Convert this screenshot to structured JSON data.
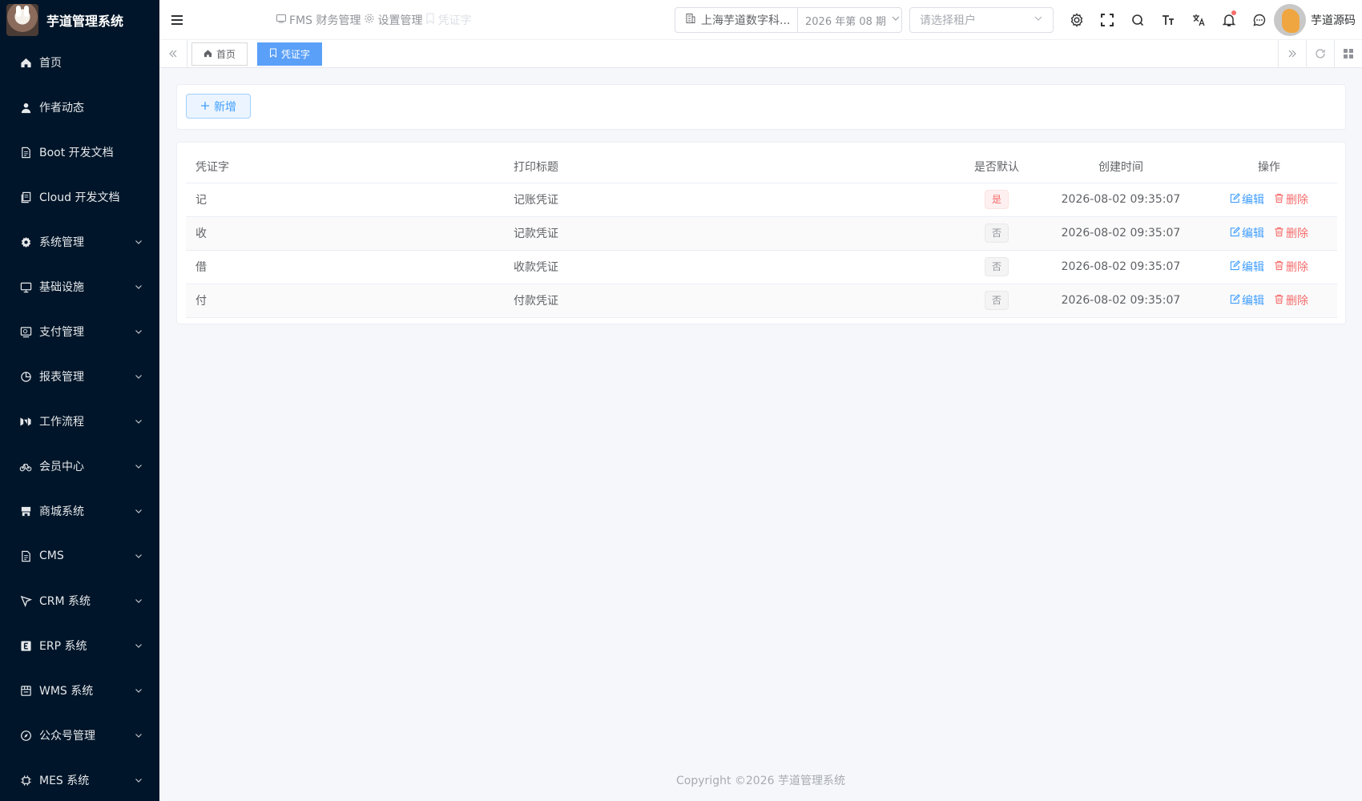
{
  "app": {
    "title": "芋道管理系统"
  },
  "sidebar": {
    "items": [
      {
        "label": "首页",
        "icon": "home-icon",
        "expandable": false
      },
      {
        "label": "作者动态",
        "icon": "user-icon",
        "expandable": false
      },
      {
        "label": "Boot 开发文档",
        "icon": "document-icon",
        "expandable": false
      },
      {
        "label": "Cloud 开发文档",
        "icon": "documents-icon",
        "expandable": false
      },
      {
        "label": "系统管理",
        "icon": "gear-icon",
        "expandable": true
      },
      {
        "label": "基础设施",
        "icon": "monitor-icon",
        "expandable": true
      },
      {
        "label": "支付管理",
        "icon": "payment-icon",
        "expandable": true
      },
      {
        "label": "报表管理",
        "icon": "pie-chart-icon",
        "expandable": true
      },
      {
        "label": "工作流程",
        "icon": "workflow-icon",
        "expandable": true
      },
      {
        "label": "会员中心",
        "icon": "bicycle-icon",
        "expandable": true
      },
      {
        "label": "商城系统",
        "icon": "store-icon",
        "expandable": true
      },
      {
        "label": "CMS",
        "icon": "document-icon",
        "expandable": true
      },
      {
        "label": "CRM 系统",
        "icon": "crm-icon",
        "expandable": true
      },
      {
        "label": "ERP 系统",
        "icon": "erp-icon",
        "expandable": true
      },
      {
        "label": "WMS 系统",
        "icon": "warehouse-icon",
        "expandable": true
      },
      {
        "label": "公众号管理",
        "icon": "compass-icon",
        "expandable": true
      },
      {
        "label": "MES 系统",
        "icon": "chip-icon",
        "expandable": true
      }
    ]
  },
  "header": {
    "nav": [
      {
        "label": "FMS 财务管理",
        "icon": "finance-icon",
        "faded": false
      },
      {
        "label": "设置管理",
        "icon": "settings-icon",
        "faded": false
      },
      {
        "label": "凭证字",
        "icon": "voucher-icon",
        "faded": true
      }
    ],
    "ledger_company": "上海芋道数字科...",
    "ledger_period": "2026 年第 08 期",
    "tenant_placeholder": "请选择租户",
    "user_name": "芋道源码"
  },
  "tags": [
    {
      "label": "首页",
      "active": false
    },
    {
      "label": "凭证字",
      "active": true
    }
  ],
  "toolbar": {
    "add_label": "新增"
  },
  "table": {
    "columns": [
      "凭证字",
      "打印标题",
      "是否默认",
      "创建时间",
      "操作"
    ],
    "rows": [
      {
        "word": "记",
        "title": "记账凭证",
        "is_default": "是",
        "default": true,
        "created": "2026-08-02 09:35:07"
      },
      {
        "word": "收",
        "title": "记款凭证",
        "is_default": "否",
        "default": false,
        "created": "2026-08-02 09:35:07"
      },
      {
        "word": "借",
        "title": "收款凭证",
        "is_default": "否",
        "default": false,
        "created": "2026-08-02 09:35:07"
      },
      {
        "word": "付",
        "title": "付款凭证",
        "is_default": "否",
        "default": false,
        "created": "2026-08-02 09:35:07"
      }
    ],
    "edit_label": "编辑",
    "delete_label": "删除"
  },
  "footer": {
    "copyright": "Copyright ©2026 芋道管理系统"
  },
  "colors": {
    "sidebar_bg": "#001529",
    "primary": "#409eff",
    "danger": "#f56c6c",
    "tag_active": "#5aa0f8"
  }
}
